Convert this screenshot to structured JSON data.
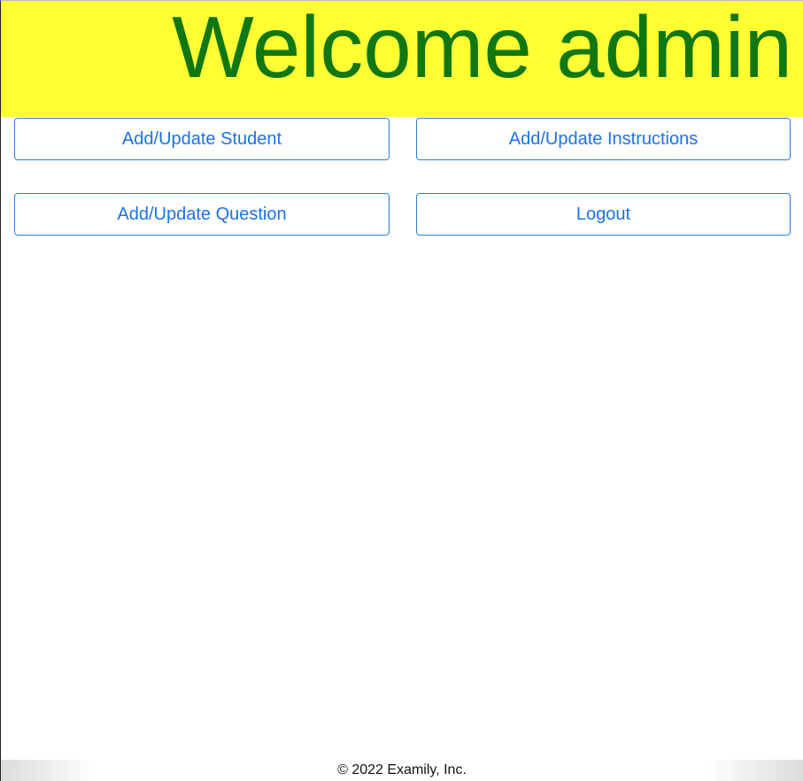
{
  "header": {
    "title": "Welcome admin",
    "background_color": "#ffff33",
    "title_color": "#117711"
  },
  "actions": {
    "add_update_student": "Add/Update Student",
    "add_update_instructions": "Add/Update Instructions",
    "add_update_question": "Add/Update Question",
    "logout": "Logout",
    "accent_color": "#1a73e8"
  },
  "footer": {
    "copyright": "© 2022 Examily, Inc."
  }
}
